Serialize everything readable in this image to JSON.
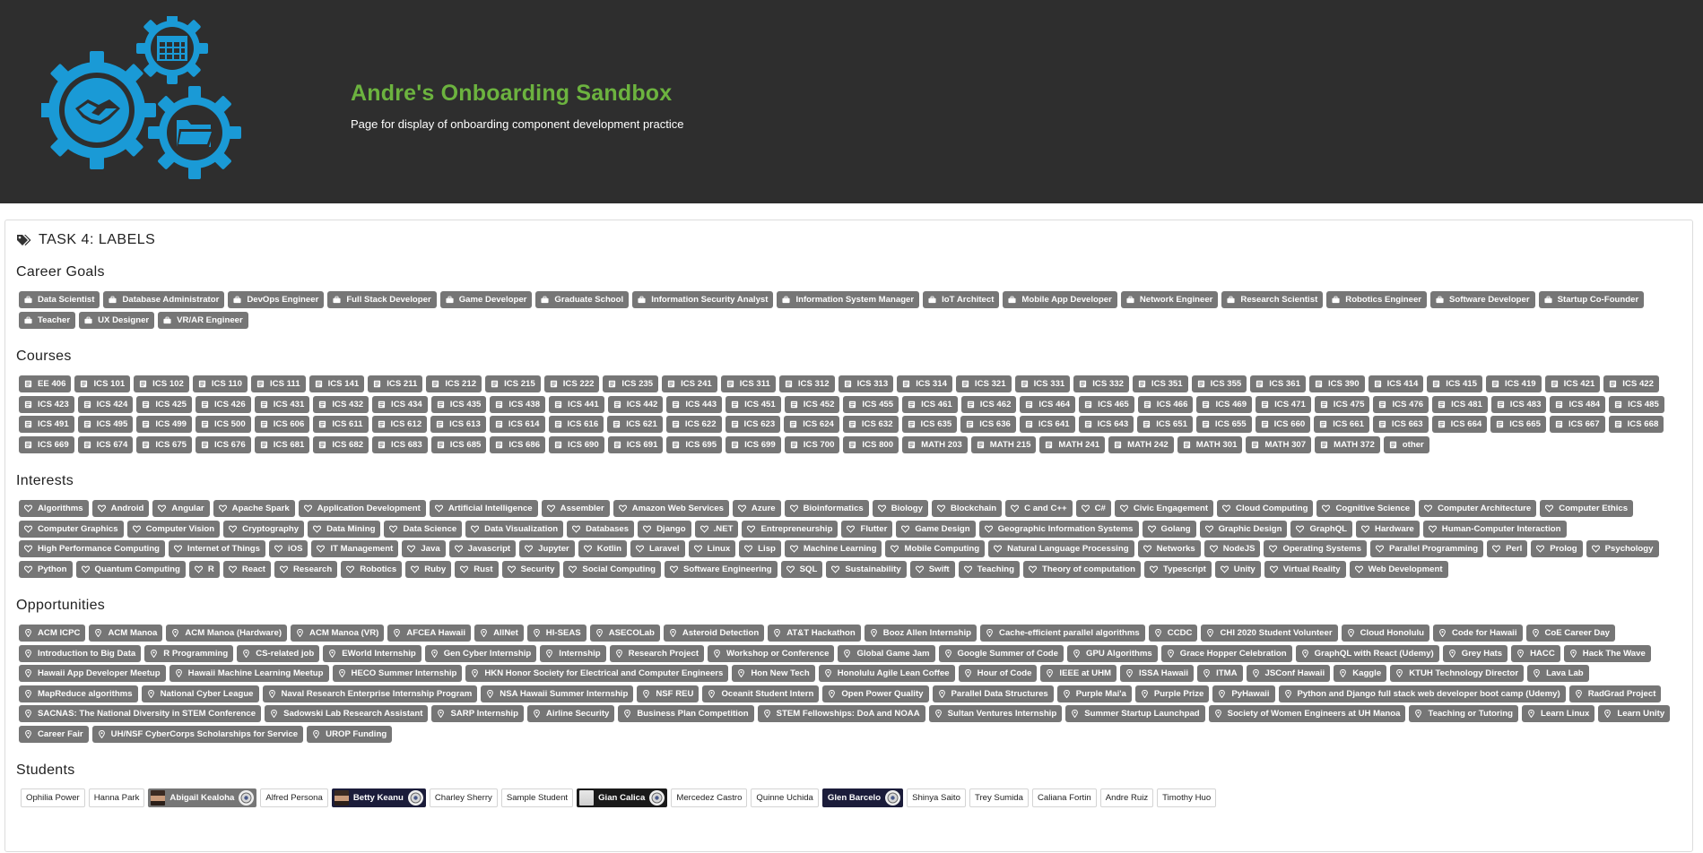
{
  "header": {
    "title": "Andre's Onboarding Sandbox",
    "subtitle": "Page for display of onboarding component development practice"
  },
  "panel": {
    "title": "TASK 4: LABELS"
  },
  "career_goals": {
    "title": "Career Goals",
    "icon": "briefcase-icon",
    "items": [
      "Data Scientist",
      "Database Administrator",
      "DevOps Engineer",
      "Full Stack Developer",
      "Game Developer",
      "Graduate School",
      "Information Security Analyst",
      "Information System Manager",
      "IoT Architect",
      "Mobile App Developer",
      "Network Engineer",
      "Research Scientist",
      "Robotics Engineer",
      "Software Developer",
      "Startup Co-Founder",
      "Teacher",
      "UX Designer",
      "VR/AR Engineer"
    ]
  },
  "courses": {
    "title": "Courses",
    "icon": "book-icon",
    "items": [
      "EE 406",
      "ICS 101",
      "ICS 102",
      "ICS 110",
      "ICS 111",
      "ICS 141",
      "ICS 211",
      "ICS 212",
      "ICS 215",
      "ICS 222",
      "ICS 235",
      "ICS 241",
      "ICS 311",
      "ICS 312",
      "ICS 313",
      "ICS 314",
      "ICS 321",
      "ICS 331",
      "ICS 332",
      "ICS 351",
      "ICS 355",
      "ICS 361",
      "ICS 390",
      "ICS 414",
      "ICS 415",
      "ICS 419",
      "ICS 421",
      "ICS 422",
      "ICS 423",
      "ICS 424",
      "ICS 425",
      "ICS 426",
      "ICS 431",
      "ICS 432",
      "ICS 434",
      "ICS 435",
      "ICS 438",
      "ICS 441",
      "ICS 442",
      "ICS 443",
      "ICS 451",
      "ICS 452",
      "ICS 455",
      "ICS 461",
      "ICS 462",
      "ICS 464",
      "ICS 465",
      "ICS 466",
      "ICS 469",
      "ICS 471",
      "ICS 475",
      "ICS 476",
      "ICS 481",
      "ICS 483",
      "ICS 484",
      "ICS 485",
      "ICS 491",
      "ICS 495",
      "ICS 499",
      "ICS 500",
      "ICS 606",
      "ICS 611",
      "ICS 612",
      "ICS 613",
      "ICS 614",
      "ICS 616",
      "ICS 621",
      "ICS 622",
      "ICS 623",
      "ICS 624",
      "ICS 632",
      "ICS 635",
      "ICS 636",
      "ICS 641",
      "ICS 643",
      "ICS 651",
      "ICS 655",
      "ICS 660",
      "ICS 661",
      "ICS 663",
      "ICS 664",
      "ICS 665",
      "ICS 667",
      "ICS 668",
      "ICS 669",
      "ICS 674",
      "ICS 675",
      "ICS 676",
      "ICS 681",
      "ICS 682",
      "ICS 683",
      "ICS 685",
      "ICS 686",
      "ICS 690",
      "ICS 691",
      "ICS 695",
      "ICS 699",
      "ICS 700",
      "ICS 800",
      "MATH 203",
      "MATH 215",
      "MATH 241",
      "MATH 242",
      "MATH 301",
      "MATH 307",
      "MATH 372",
      "other"
    ]
  },
  "interests": {
    "title": "Interests",
    "icon": "heart-icon",
    "items": [
      "Algorithms",
      "Android",
      "Angular",
      "Apache Spark",
      "Application Development",
      "Artificial Intelligence",
      "Assembler",
      "Amazon Web Services",
      "Azure",
      "Bioinformatics",
      "Biology",
      "Blockchain",
      "C and C++",
      "C#",
      "Civic Engagement",
      "Cloud Computing",
      "Cognitive Science",
      "Computer Architecture",
      "Computer Ethics",
      "Computer Graphics",
      "Computer Vision",
      "Cryptography",
      "Data Mining",
      "Data Science",
      "Data Visualization",
      "Databases",
      "Django",
      ".NET",
      "Entrepreneurship",
      "Flutter",
      "Game Design",
      "Geographic Information Systems",
      "Golang",
      "Graphic Design",
      "GraphQL",
      "Hardware",
      "Human-Computer Interaction",
      "High Performance Computing",
      "Internet of Things",
      "iOS",
      "IT Management",
      "Java",
      "Javascript",
      "Jupyter",
      "Kotlin",
      "Laravel",
      "Linux",
      "Lisp",
      "Machine Learning",
      "Mobile Computing",
      "Natural Language Processing",
      "Networks",
      "NodeJS",
      "Operating Systems",
      "Parallel Programming",
      "Perl",
      "Prolog",
      "Psychology",
      "Python",
      "Quantum Computing",
      "R",
      "React",
      "Research",
      "Robotics",
      "Ruby",
      "Rust",
      "Security",
      "Social Computing",
      "Software Engineering",
      "SQL",
      "Sustainability",
      "Swift",
      "Teaching",
      "Theory of computation",
      "Typescript",
      "Unity",
      "Virtual Reality",
      "Web Development"
    ]
  },
  "opportunities": {
    "title": "Opportunities",
    "icon": "map-marker-icon",
    "items": [
      "ACM ICPC",
      "ACM Manoa",
      "ACM Manoa (Hardware)",
      "ACM Manoa (VR)",
      "AFCEA Hawaii",
      "AllNet",
      "HI-SEAS",
      "ASECOLab",
      "Asteroid Detection",
      "AT&T Hackathon",
      "Booz Allen Internship",
      "Cache-efficient parallel algorithms",
      "CCDC",
      "CHI 2020 Student Volunteer",
      "Cloud Honolulu",
      "Code for Hawaii",
      "CoE Career Day",
      "Introduction to Big Data",
      "R Programming",
      "CS-related job",
      "EWorld Internship",
      "Gen Cyber Internship",
      "Internship",
      "Research Project",
      "Workshop or Conference",
      "Global Game Jam",
      "Google Summer of Code",
      "GPU Algorithms",
      "Grace Hopper Celebration",
      "GraphQL with React (Udemy)",
      "Grey Hats",
      "HACC",
      "Hack The Wave",
      "Hawaii App Developer Meetup",
      "Hawaii Machine Learning Meetup",
      "HECO Summer Internship",
      "HKN Honor Society for Electrical and Computer Engineers",
      "Hon New Tech",
      "Honolulu Agile Lean Coffee",
      "Hour of Code",
      "IEEE at UHM",
      "ISSA Hawaii",
      "ITMA",
      "JSConf Hawaii",
      "Kaggle",
      "KTUH Technology Director",
      "Lava Lab",
      "MapReduce algorithms",
      "National Cyber League",
      "Naval Research Enterprise Internship Program",
      "NSA Hawaii Summer Internship",
      "NSF REU",
      "Oceanit Student Intern",
      "Open Power Quality",
      "Parallel Data Structures",
      "Purple Mai'a",
      "Purple Prize",
      "PyHawaii",
      "Python and Django full stack web developer boot camp (Udemy)",
      "RadGrad Project",
      "SACNAS: The National Diversity in STEM Conference",
      "Sadowski Lab Research Assistant",
      "SARP Internship",
      "Airline Security",
      "Business Plan Competition",
      "STEM Fellowships: DoA and NOAA",
      "Sultan Ventures Internship",
      "Summer Startup Launchpad",
      "Society of Women Engineers at UH Manoa",
      "Teaching or Tutoring",
      "Learn Linux",
      "Learn Unity",
      "Career Fair",
      "UH/NSF CyberCorps Scholarships for Service",
      "UROP Funding"
    ]
  },
  "students": {
    "title": "Students",
    "items": [
      {
        "name": "Ophilia Power",
        "style": "plain"
      },
      {
        "name": "Hanna Park",
        "style": "plain"
      },
      {
        "name": "Abigail Kealoha",
        "style": "gray",
        "avatar": true,
        "badge": true
      },
      {
        "name": "Alfred Persona",
        "style": "plain"
      },
      {
        "name": "Betty Keanu",
        "style": "navy",
        "avatar": true,
        "badge": true
      },
      {
        "name": "Charley Sherry",
        "style": "plain"
      },
      {
        "name": "Sample Student",
        "style": "plain"
      },
      {
        "name": "Gian Calica",
        "style": "black",
        "avatar": true,
        "badge": true
      },
      {
        "name": "Mercedez Castro",
        "style": "plain"
      },
      {
        "name": "Quinne Uchida",
        "style": "plain"
      },
      {
        "name": "Glen Barcelo",
        "style": "navy",
        "badge": true
      },
      {
        "name": "Shinya Saito",
        "style": "plain"
      },
      {
        "name": "Trey Sumida",
        "style": "plain"
      },
      {
        "name": "Caliana Fortin",
        "style": "plain"
      },
      {
        "name": "Andre Ruiz",
        "style": "plain"
      },
      {
        "name": "Timothy Huo",
        "style": "plain"
      }
    ]
  },
  "colors": {
    "header_bg": "#2e2e2e",
    "title_green": "#6cb33f",
    "logo_blue": "#1a9ad6",
    "label_gray": "#767676",
    "navy": "#1b1c3a"
  }
}
